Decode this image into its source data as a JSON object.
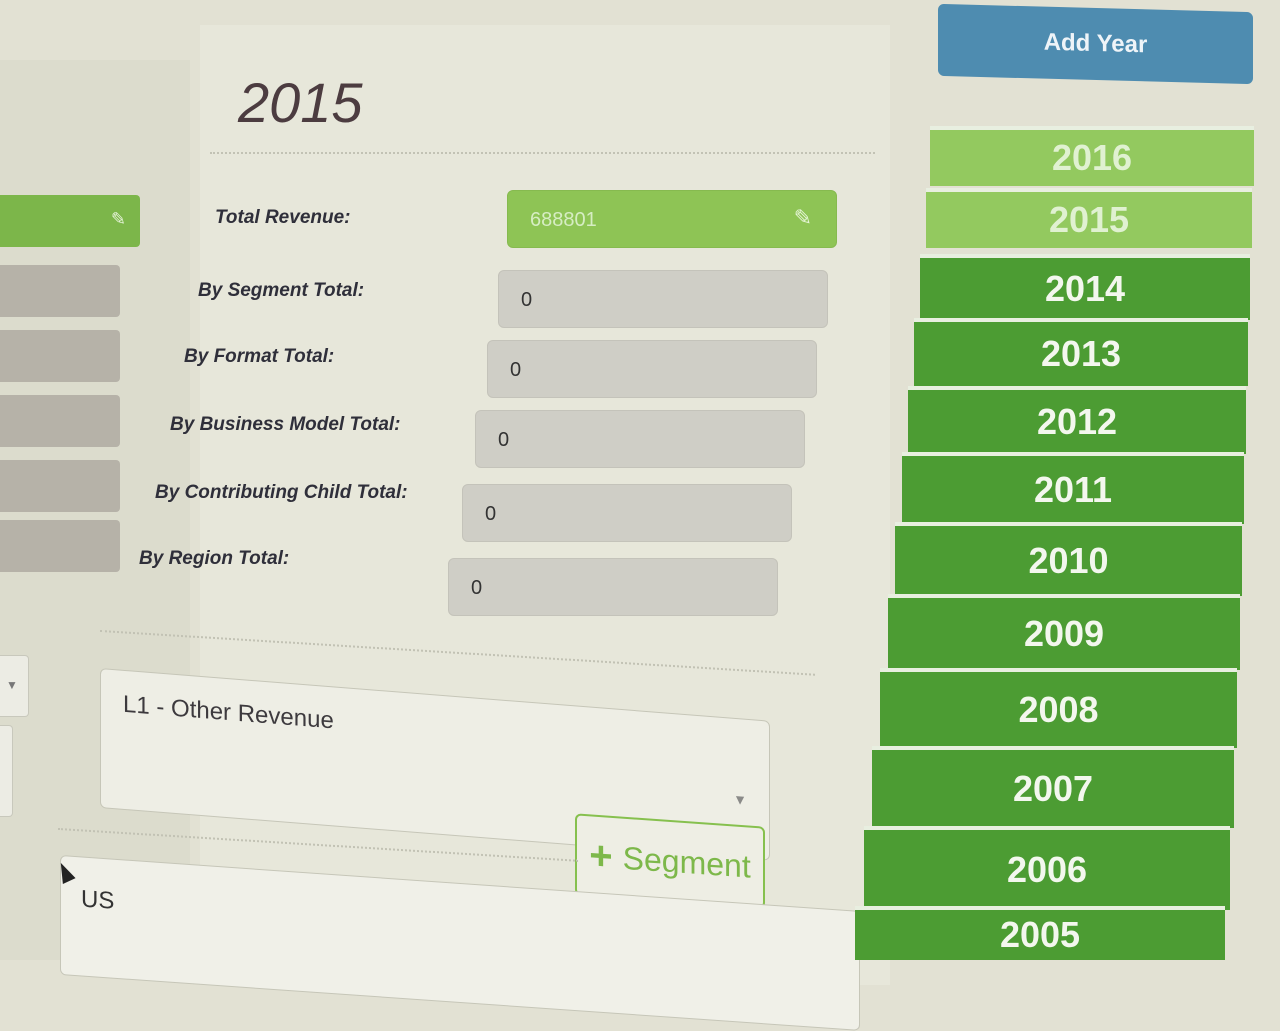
{
  "page": {
    "year_title": "2015"
  },
  "form": {
    "total_revenue": {
      "label": "Total Revenue:",
      "value": "688801"
    },
    "by_segment": {
      "label": "By Segment Total:",
      "value": "0"
    },
    "by_format": {
      "label": "By Format Total:",
      "value": "0"
    },
    "by_business_model": {
      "label": "By Business Model Total:",
      "value": "0"
    },
    "by_contributing_child": {
      "label": "By Contributing Child Total:",
      "value": "0"
    },
    "by_region": {
      "label": "By Region Total:",
      "value": "0"
    }
  },
  "segment_select": {
    "value": "L1 - Other Revenue"
  },
  "segment_button": {
    "label": "Segment"
  },
  "region_field": {
    "value": "US"
  },
  "sidebar": {
    "add_year_label": "Add Year",
    "years": [
      "2016",
      "2015",
      "2014",
      "2013",
      "2012",
      "2011",
      "2010",
      "2009",
      "2008",
      "2007",
      "2006",
      "2005"
    ],
    "selected_year": "2015"
  },
  "colors": {
    "accent_green": "#8ec455",
    "dark_green": "#4c9c33",
    "add_year_blue": "#4e8cb0"
  }
}
